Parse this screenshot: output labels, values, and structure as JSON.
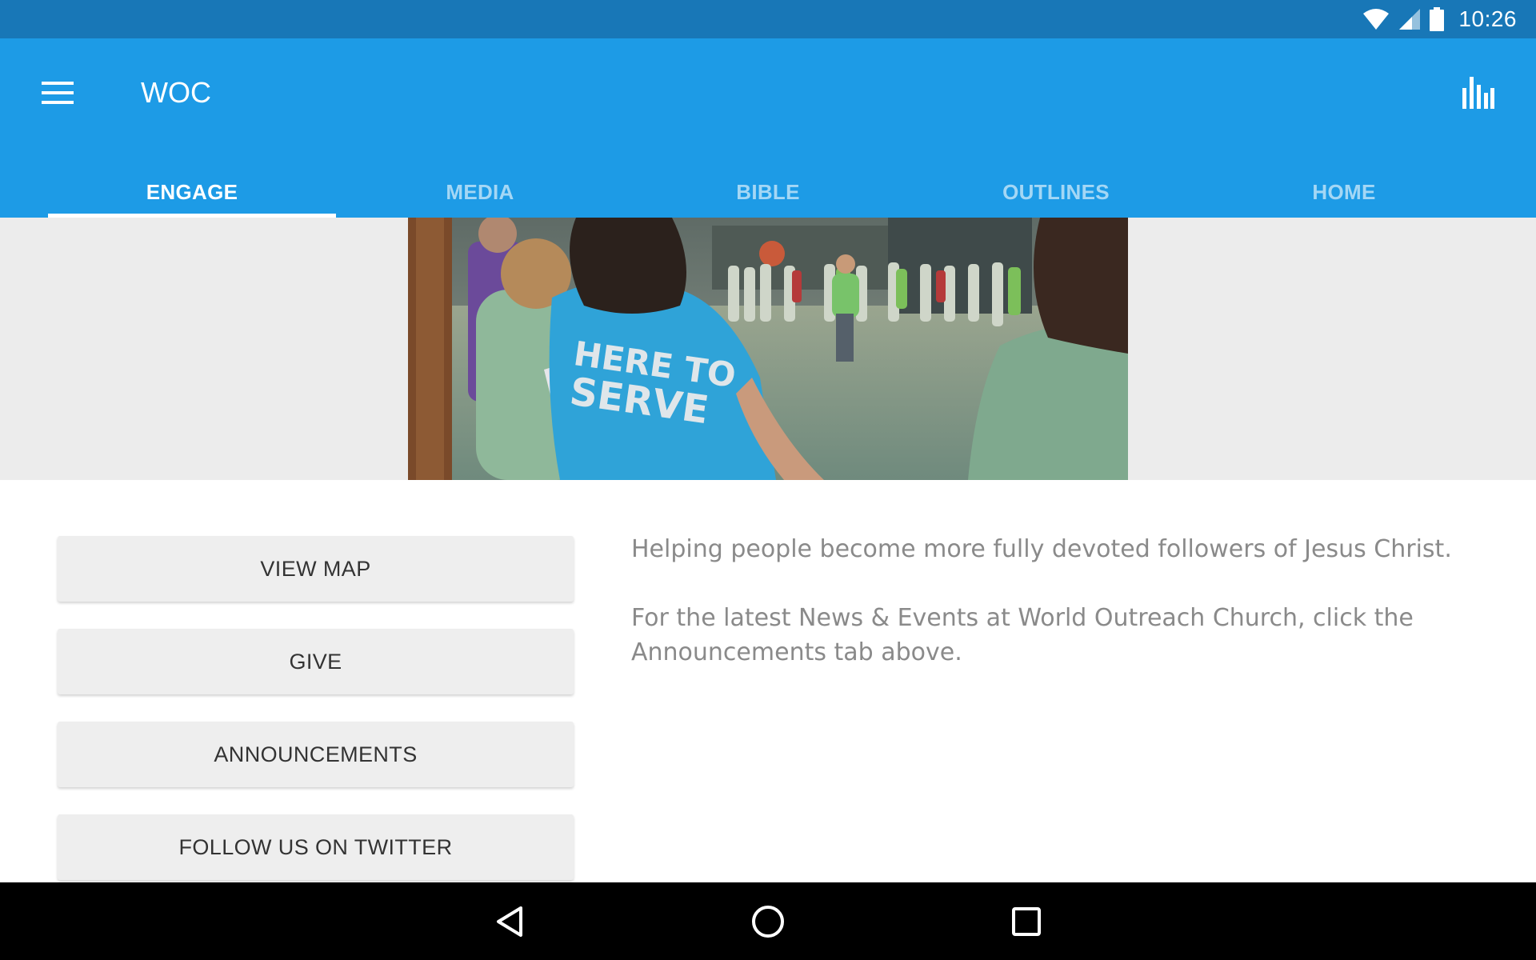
{
  "status_bar": {
    "time": "10:26",
    "icons": [
      "wifi-icon",
      "cell-signal-icon",
      "battery-icon"
    ]
  },
  "app_bar": {
    "title": "WOC",
    "menu_icon": "hamburger-menu-icon",
    "action_icon": "bar-chart-icon",
    "color": "#1d9be6"
  },
  "tabs": [
    {
      "label": "ENGAGE",
      "active": true
    },
    {
      "label": "MEDIA",
      "active": false
    },
    {
      "label": "BIBLE",
      "active": false
    },
    {
      "label": "OUTLINES",
      "active": false
    },
    {
      "label": "HOME",
      "active": false
    }
  ],
  "hero": {
    "shirt_text": "HERE TO SERVE"
  },
  "buttons": [
    {
      "label": "VIEW MAP"
    },
    {
      "label": "GIVE"
    },
    {
      "label": "ANNOUNCEMENTS"
    },
    {
      "label": "FOLLOW US ON TWITTER"
    }
  ],
  "description": {
    "tagline": "Helping people become more fully devoted followers of Jesus Christ.",
    "news": "For the latest News & Events at World Outreach Church, click the Announcements tab above."
  },
  "nav_bar": {
    "icons": [
      "back-icon",
      "home-icon",
      "recents-icon"
    ]
  }
}
